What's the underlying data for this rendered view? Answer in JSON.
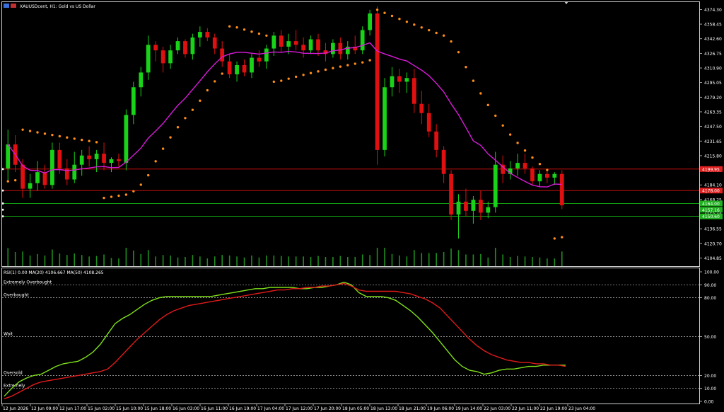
{
  "header": {
    "symbol_title": "XAUUSDcent, H1:  Gold vs US Dollar"
  },
  "rsi_header": "RSI(1) 0.00 MA(20) 4106.667 MA(50) 4108.265",
  "rsi_levels": [
    {
      "label": "Extremely Overbought",
      "value": 90
    },
    {
      "label": "Overbought",
      "value": 80
    },
    {
      "label": "Wait",
      "value": 50
    },
    {
      "label": "Oversold",
      "value": 20
    },
    {
      "label": "Extremely",
      "value": 10
    }
  ],
  "price_tags": [
    {
      "text": "4199.95",
      "value": 4201.3,
      "color": "#e02020"
    },
    {
      "text": "4178.00",
      "value": 4178.0,
      "color": "#e02020"
    },
    {
      "text": "4164.00",
      "value": 4164.0,
      "color": "#20b020"
    },
    {
      "text": "4157.16",
      "value": 4157.2,
      "color": "#20b020"
    },
    {
      "text": "4150.60",
      "value": 4150.0,
      "color": "#20b020"
    }
  ],
  "colors": {
    "bull": "#19d319",
    "bear": "#e01010",
    "ma": "#d91ad9",
    "sar": "#ff8c1a",
    "volume": "#1f8f1f",
    "rsi_ma_fast": "#7fe01a",
    "rsi_ma_slow": "#e01a1a",
    "frame": "#cfcfcf"
  },
  "chart_data": {
    "type": "candlestick",
    "title": "XAUUSDcent, H1:  Gold vs US Dollar",
    "ylim": [
      4096,
      4380
    ],
    "y_ticks": [
      "4374.30",
      "4358.45",
      "4342.60",
      "4326.75",
      "4310.90",
      "4295.05",
      "4279.20",
      "4263.35",
      "4247.50",
      "4231.65",
      "4215.80",
      "4199.95",
      "4184.10",
      "4168.25",
      "4152.40",
      "4136.55",
      "4120.70",
      "4104.85"
    ],
    "x_ticks": [
      "12 Jun 2026",
      "12 Jun 09:00",
      "12 Jun 17:00",
      "15 Jun 02:00",
      "15 Jun 10:00",
      "15 Jun 18:00",
      "16 Jun 03:00",
      "16 Jun 11:00",
      "16 Jun 19:00",
      "17 Jun 04:00",
      "17 Jun 12:00",
      "17 Jun 20:00",
      "18 Jun 05:00",
      "18 Jun 13:00",
      "18 Jun 21:00",
      "19 Jun 06:00",
      "19 Jun 14:00",
      "22 Jun 03:00",
      "22 Jun 11:00",
      "22 Jun 19:00",
      "23 Jun 04:00"
    ],
    "horizontal_levels": [
      4201.3,
      4178.0,
      4164.0,
      4150.0
    ],
    "rsi_panel": {
      "ylim": [
        0,
        100
      ],
      "y_ticks": [
        "100.00",
        "90.00",
        "80.00",
        "50.00",
        "20.00",
        "10.00",
        "0.00"
      ],
      "levels": [
        90,
        80,
        50,
        20,
        10
      ],
      "series": [
        {
          "name": "MA(20)",
          "values": [
            4,
            10,
            15,
            18,
            20,
            21,
            24,
            27,
            29,
            30,
            31,
            34,
            38,
            44,
            52,
            60,
            64,
            67,
            71,
            75,
            78,
            80,
            81,
            81,
            81,
            81,
            81,
            81,
            81,
            82,
            83,
            84,
            85,
            86,
            87,
            87,
            88,
            88,
            88,
            88,
            87,
            87,
            88,
            88,
            89,
            90,
            92,
            90,
            84,
            81,
            81,
            81,
            80,
            78,
            74,
            70,
            65,
            59,
            53,
            46,
            39,
            32,
            27,
            24,
            23,
            21,
            22,
            24,
            25,
            25,
            26,
            27,
            27,
            28,
            28,
            28,
            28
          ]
        },
        {
          "name": "MA(50)",
          "values": [
            2,
            4,
            7,
            10,
            13,
            15,
            16,
            17,
            18,
            19,
            20,
            21,
            22,
            23,
            25,
            30,
            36,
            42,
            48,
            53,
            58,
            63,
            67,
            70,
            72,
            74,
            75,
            76,
            77,
            78,
            79,
            80,
            81,
            82,
            83,
            84,
            85,
            86,
            86,
            87,
            87,
            88,
            88,
            89,
            89,
            90,
            91,
            89,
            86,
            85,
            85,
            85,
            85,
            85,
            84,
            83,
            81,
            79,
            76,
            72,
            66,
            60,
            54,
            48,
            43,
            39,
            36,
            34,
            32,
            31,
            30,
            30,
            29,
            29,
            28,
            28,
            27
          ]
        }
      ]
    },
    "candles": [
      [
        4202,
        4244,
        4188,
        4228
      ],
      [
        4228,
        4238,
        4198,
        4206
      ],
      [
        4206,
        4212,
        4170,
        4180
      ],
      [
        4180,
        4196,
        4170,
        4186
      ],
      [
        4186,
        4210,
        4178,
        4198
      ],
      [
        4198,
        4206,
        4180,
        4184
      ],
      [
        4184,
        4230,
        4180,
        4222
      ],
      [
        4222,
        4230,
        4196,
        4202
      ],
      [
        4202,
        4212,
        4184,
        4190
      ],
      [
        4190,
        4220,
        4186,
        4206
      ],
      [
        4206,
        4222,
        4194,
        4216
      ],
      [
        4216,
        4226,
        4204,
        4212
      ],
      [
        4212,
        4222,
        4198,
        4218
      ],
      [
        4218,
        4230,
        4200,
        4208
      ],
      [
        4208,
        4214,
        4198,
        4212
      ],
      [
        4212,
        4218,
        4204,
        4210
      ],
      [
        4208,
        4266,
        4200,
        4260
      ],
      [
        4260,
        4296,
        4250,
        4290
      ],
      [
        4290,
        4312,
        4280,
        4306
      ],
      [
        4306,
        4346,
        4298,
        4336
      ],
      [
        4336,
        4340,
        4318,
        4330
      ],
      [
        4330,
        4334,
        4306,
        4316
      ],
      [
        4316,
        4336,
        4310,
        4330
      ],
      [
        4330,
        4344,
        4326,
        4340
      ],
      [
        4340,
        4342,
        4322,
        4326
      ],
      [
        4326,
        4348,
        4320,
        4344
      ],
      [
        4344,
        4356,
        4334,
        4350
      ],
      [
        4350,
        4354,
        4340,
        4344
      ],
      [
        4344,
        4348,
        4326,
        4332
      ],
      [
        4332,
        4340,
        4312,
        4318
      ],
      [
        4318,
        4326,
        4300,
        4304
      ],
      [
        4304,
        4318,
        4296,
        4314
      ],
      [
        4314,
        4320,
        4302,
        4306
      ],
      [
        4306,
        4326,
        4300,
        4322
      ],
      [
        4322,
        4330,
        4312,
        4318
      ],
      [
        4318,
        4336,
        4310,
        4332
      ],
      [
        4332,
        4350,
        4324,
        4346
      ],
      [
        4346,
        4352,
        4328,
        4334
      ],
      [
        4334,
        4348,
        4326,
        4340
      ],
      [
        4340,
        4352,
        4330,
        4336
      ],
      [
        4336,
        4344,
        4322,
        4330
      ],
      [
        4330,
        4346,
        4326,
        4342
      ],
      [
        4342,
        4348,
        4324,
        4330
      ],
      [
        4330,
        4338,
        4318,
        4326
      ],
      [
        4326,
        4342,
        4322,
        4338
      ],
      [
        4338,
        4344,
        4320,
        4326
      ],
      [
        4326,
        4340,
        4320,
        4334
      ],
      [
        4334,
        4346,
        4326,
        4330
      ],
      [
        4330,
        4356,
        4326,
        4352
      ],
      [
        4352,
        4374,
        4346,
        4370
      ],
      [
        4370,
        4378,
        4206,
        4222
      ],
      [
        4222,
        4300,
        4215,
        4290
      ],
      [
        4290,
        4312,
        4280,
        4302
      ],
      [
        4302,
        4310,
        4284,
        4296
      ],
      [
        4296,
        4306,
        4284,
        4300
      ],
      [
        4300,
        4310,
        4262,
        4272
      ],
      [
        4272,
        4286,
        4250,
        4262
      ],
      [
        4262,
        4272,
        4236,
        4242
      ],
      [
        4242,
        4250,
        4214,
        4222
      ],
      [
        4222,
        4226,
        4186,
        4196
      ],
      [
        4196,
        4200,
        4146,
        4152
      ],
      [
        4152,
        4174,
        4126,
        4166
      ],
      [
        4166,
        4180,
        4150,
        4156
      ],
      [
        4156,
        4172,
        4142,
        4168
      ],
      [
        4168,
        4178,
        4146,
        4154
      ],
      [
        4154,
        4166,
        4148,
        4160
      ],
      [
        4160,
        4220,
        4154,
        4206
      ],
      [
        4206,
        4216,
        4186,
        4196
      ],
      [
        4196,
        4210,
        4190,
        4202
      ],
      [
        4202,
        4218,
        4194,
        4208
      ],
      [
        4208,
        4218,
        4196,
        4202
      ],
      [
        4202,
        4204,
        4184,
        4188
      ],
      [
        4188,
        4200,
        4182,
        4196
      ],
      [
        4196,
        4200,
        4186,
        4192
      ],
      [
        4192,
        4198,
        4184,
        4196
      ],
      [
        4196,
        4200,
        4158,
        4162
      ]
    ]
  }
}
